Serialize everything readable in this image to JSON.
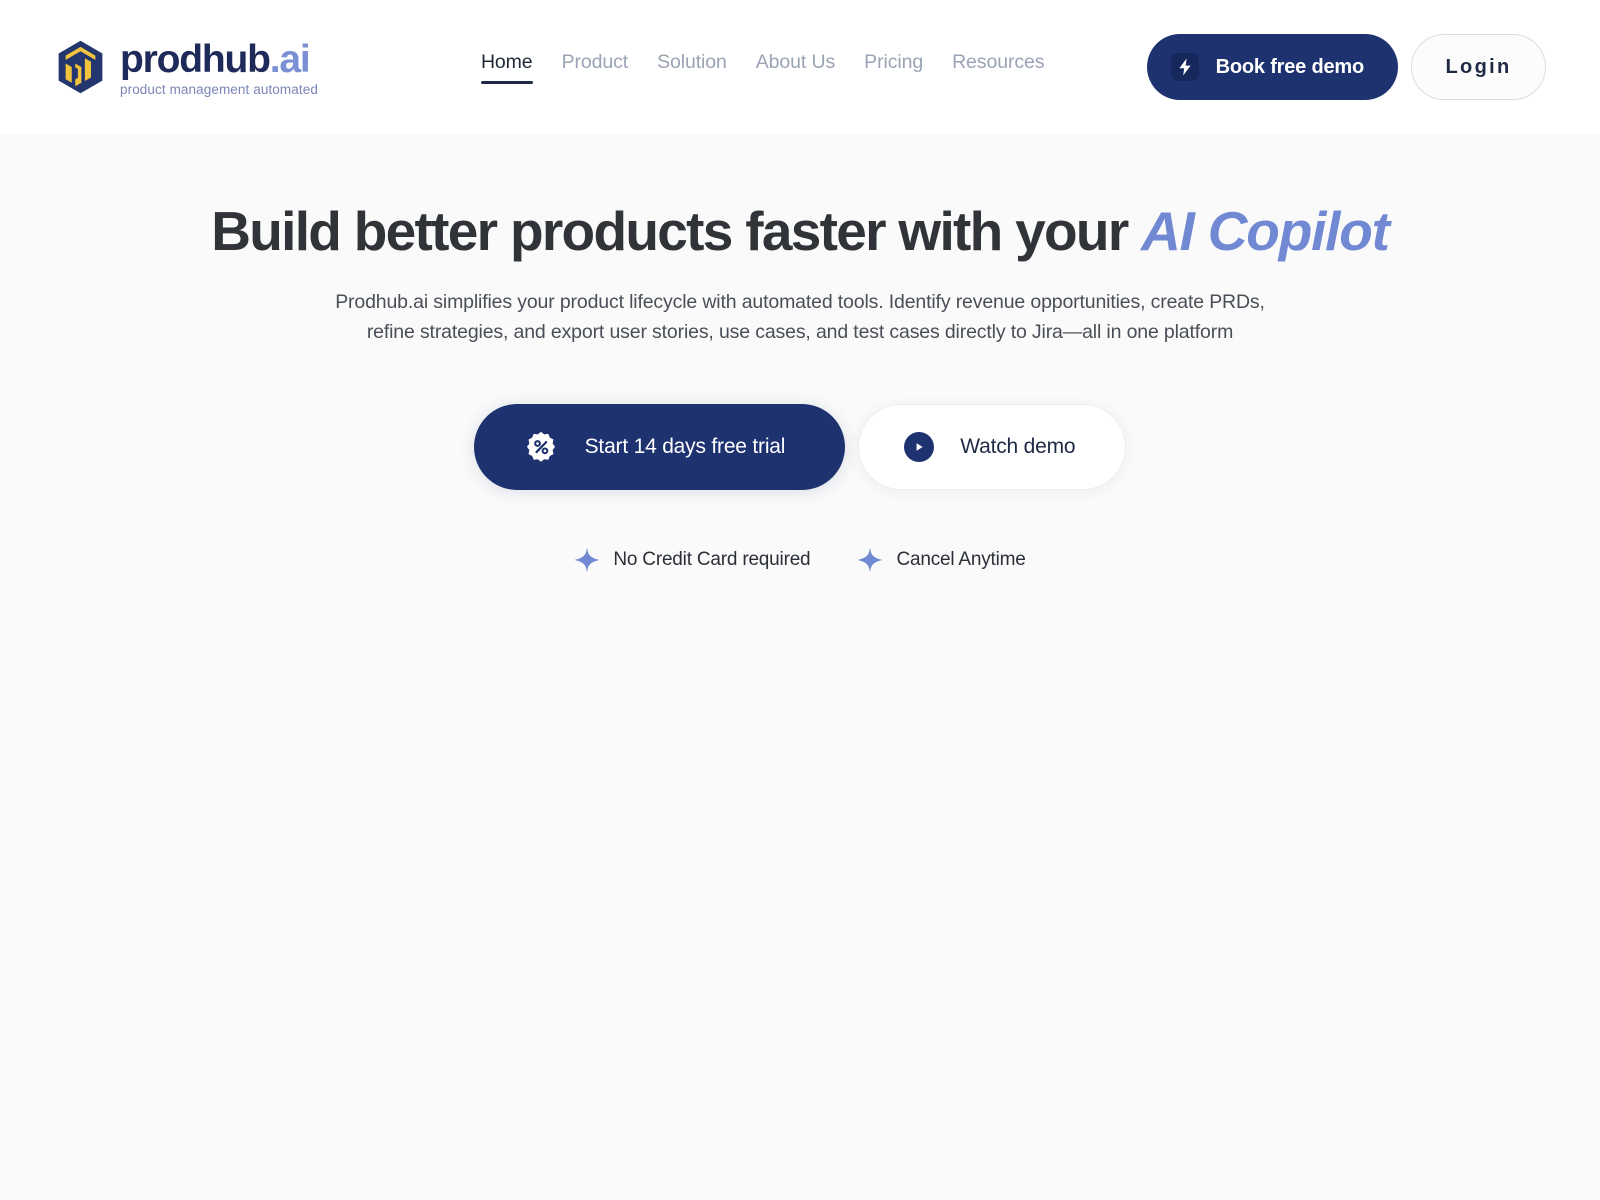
{
  "brand": {
    "name_main": "prodhub",
    "name_suffix": ".ai",
    "tagline": "product management automated",
    "logo_icon": "cube-box-logo-icon"
  },
  "nav": {
    "items": [
      {
        "label": "Home",
        "active": true
      },
      {
        "label": "Product",
        "active": false
      },
      {
        "label": "Solution",
        "active": false
      },
      {
        "label": "About Us",
        "active": false
      },
      {
        "label": "Pricing",
        "active": false
      },
      {
        "label": "Resources",
        "active": false
      }
    ]
  },
  "header_actions": {
    "demo_label": "Book free demo",
    "demo_icon": "lightning-bolt-icon",
    "login_label": "Login"
  },
  "hero": {
    "title_lead": "Build better products faster with your ",
    "title_accent": "AI Copilot",
    "subtitle_line1": "Prodhub.ai simplifies your product lifecycle with automated tools. Identify revenue opportunities, create PRDs,",
    "subtitle_line2": "refine strategies, and export user stories, use cases, and test cases directly to Jira—all in one platform",
    "cta_primary_label": "Start 14 days free trial",
    "cta_primary_icon": "discount-badge-percent-icon",
    "cta_secondary_label": "Watch demo",
    "cta_secondary_icon": "play-circle-icon",
    "notes": [
      {
        "label": "No Credit Card required",
        "icon": "sparkle-star-icon"
      },
      {
        "label": "Cancel Anytime",
        "icon": "sparkle-star-icon"
      }
    ]
  },
  "colors": {
    "navy": "#1e3270",
    "brand_navy": "#1e2a5a",
    "periwinkle": "#7189d2",
    "logo_gold": "#f2c33d",
    "muted_nav": "#9aa3b5",
    "page_bg": "#fafafa",
    "header_bg": "#ffffff",
    "heading": "#303438"
  }
}
